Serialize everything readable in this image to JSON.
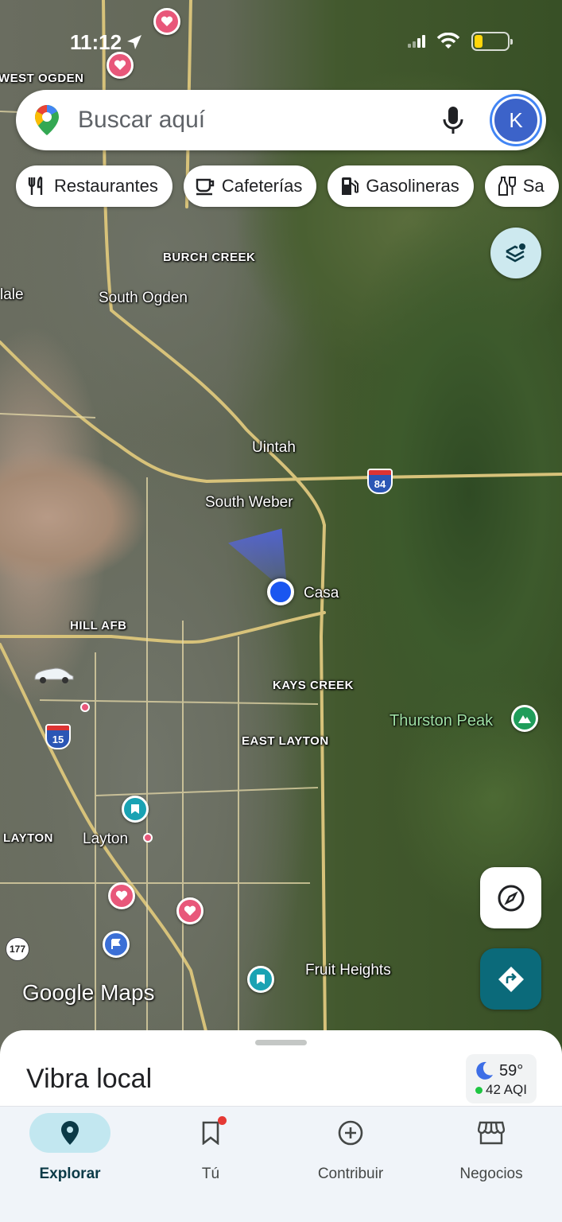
{
  "status_bar": {
    "time": "11:12"
  },
  "search": {
    "placeholder": "Buscar aquí",
    "avatar_letter": "K"
  },
  "chips": [
    {
      "label": "Restaurantes",
      "icon": "utensils-icon"
    },
    {
      "label": "Cafeterías",
      "icon": "coffee-icon"
    },
    {
      "label": "Gasolineras",
      "icon": "gas-pump-icon"
    },
    {
      "label": "Sa",
      "icon": "wine-icon"
    }
  ],
  "map": {
    "labels": {
      "west_ogden": "WEST OGDEN",
      "burch_creek": "BURCH CREEK",
      "dale": "lale",
      "south_ogden": "South Ogden",
      "uintah": "Uintah",
      "south_weber": "South Weber",
      "casa": "Casa",
      "hill_afb": "HILL AFB",
      "kays_creek": "KAYS CREEK",
      "thurston_peak": "Thurston Peak",
      "east_layton": "EAST LAYTON",
      "layton_caps": "LAYTON",
      "layton": "Layton",
      "fruit_heights": "Fruit Heights"
    },
    "shields": {
      "i84": "84",
      "i15": "15",
      "r177": "177"
    },
    "watermark": "Google Maps"
  },
  "sheet": {
    "title": "Vibra local",
    "weather": {
      "temp": "59°",
      "aqi": "42 AQI"
    }
  },
  "bottom_nav": [
    {
      "label": "Explorar",
      "active": true
    },
    {
      "label": "Tú",
      "active": false
    },
    {
      "label": "Contribuir",
      "active": false
    },
    {
      "label": "Negocios",
      "active": false
    }
  ],
  "colors": {
    "accent_teal": "#0b6a7a",
    "location_blue": "#1a56f0",
    "heart_pin": "#e8577a"
  }
}
